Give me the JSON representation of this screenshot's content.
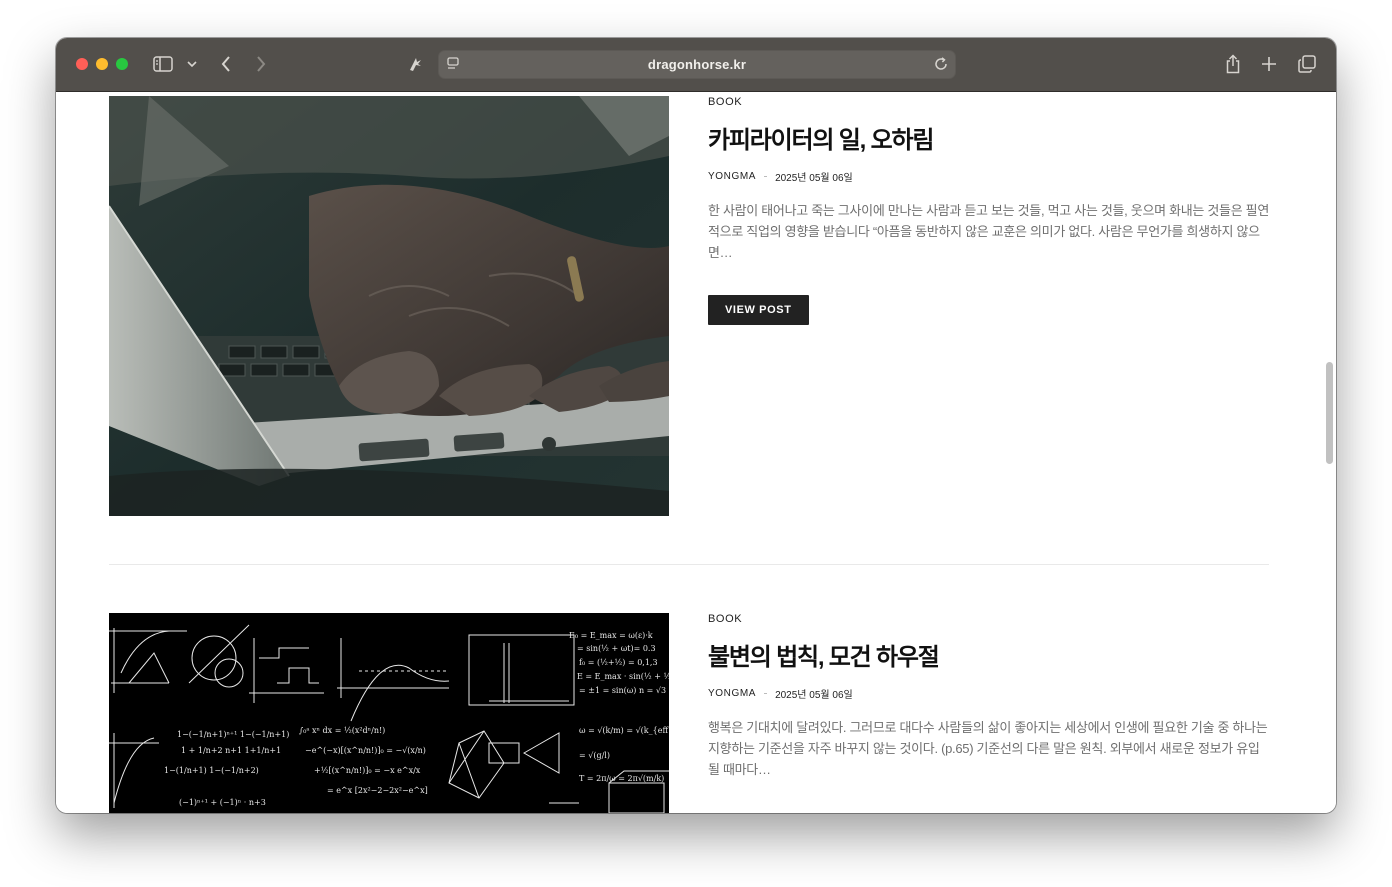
{
  "browser": {
    "url": "dragonhorse.kr",
    "icons": [
      "sidebar-icon",
      "chevron-down-icon",
      "back-icon",
      "forward-icon",
      "extension-icon",
      "page-menu-icon",
      "reload-icon",
      "share-icon",
      "new-tab-icon",
      "tab-overview-icon"
    ],
    "traffic_lights": [
      "#ff5f57",
      "#febc2e",
      "#28c840"
    ]
  },
  "posts": [
    {
      "category": "BOOK",
      "title": "카피라이터의 일, 오하림",
      "author": "YONGMA",
      "date": "2025년 05월 06일",
      "excerpt": "한 사람이 태어나고 죽는 그사이에 만나는 사람과 듣고 보는 것들, 먹고 사는 것들, 웃으며 화내는 것들은 필연적으로 직업의 영향을 받습니다 “아픔을 동반하지 않은 교훈은 의미가 없다. 사람은 무언가를 희생하지 않으면…",
      "button_label": "VIEW POST",
      "image": "hands-typing-on-laptop-photo"
    },
    {
      "category": "BOOK",
      "title": "불변의 법칙, 모건 하우절",
      "author": "YONGMA",
      "date": "2025년 05월 06일",
      "excerpt": "행복은 기대치에 달려있다. 그러므로 대다수 사람들의 삶이 좋아지는 세상에서 인생에 필요한 기술 중 하나는 지향하는 기준선을 자주 바꾸지 않는 것이다. (p.65) 기준선의 다른 말은 원칙. 외부에서 새로운 정보가 유입될 때마다…",
      "image": "math-formulas-blackboard-image"
    }
  ]
}
